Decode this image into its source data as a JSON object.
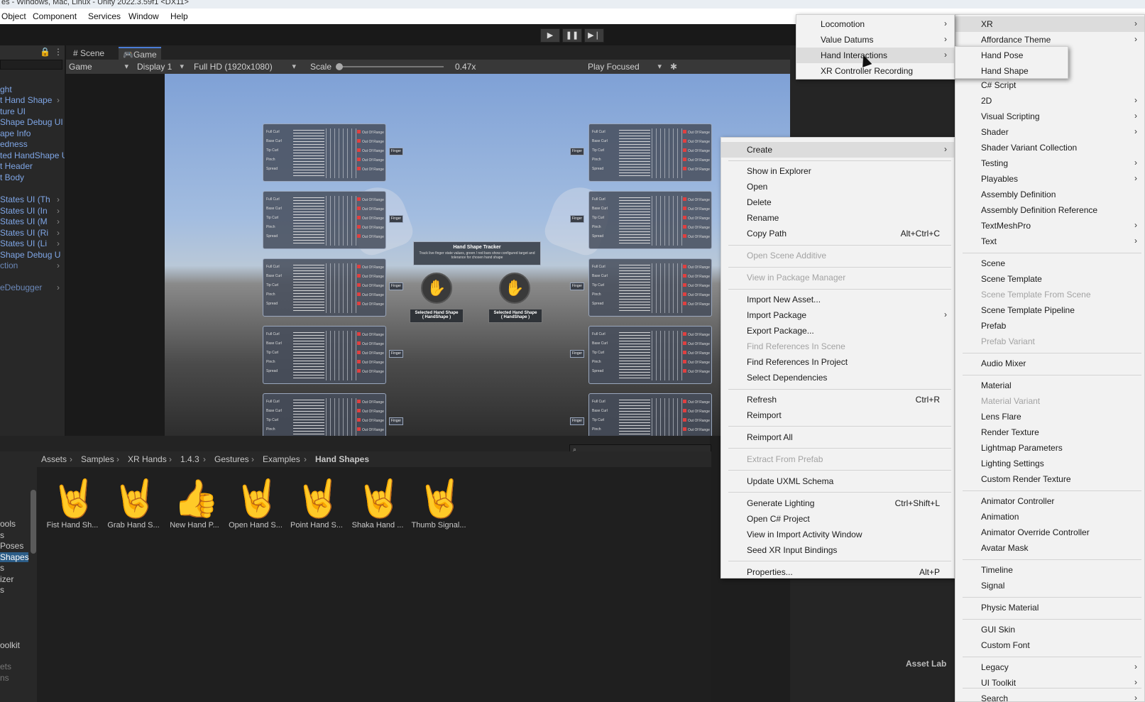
{
  "window": {
    "title": "es - Windows, Mac, Linux - Unity 2022.3.59f1 <DX11>"
  },
  "menubar": [
    "Object",
    "Component",
    "Services",
    "Window",
    "Help"
  ],
  "play_controls": {
    "play": "▶",
    "pause": "❚❚",
    "step": "▶❘"
  },
  "hierarchy": {
    "items": [
      "ght",
      "t Hand Shape",
      "ture UI",
      "Shape Debug UI",
      "ape Info",
      "edness",
      "ted HandShape U",
      "t Header",
      "t Body",
      "",
      "States UI (Th",
      "States UI (In",
      "States UI (M",
      "States UI (Ri",
      "States UI (Li",
      "Shape Debug U",
      "ction",
      "",
      "eDebugger"
    ]
  },
  "game_view": {
    "tabs": [
      "Scene",
      "Game"
    ],
    "mode": "Game",
    "display": "Display 1",
    "resolution": "Full HD (1920x1080)",
    "scale_label": "Scale",
    "scale_value": "0.47x",
    "play_mode": "Play Focused",
    "panel_rows": [
      "Full Curl",
      "Base Curl",
      "Tip Curl",
      "Pinch",
      "Spread"
    ],
    "out_of_range": "Out Of Range",
    "finger_tag": "Finger",
    "tracker_title": "Hand Shape Tracker",
    "tracker_desc": "Track live finger state values, green / red bars show configured target and tolerance for chosen hand shape",
    "selected_label": "Selected Hand Shape",
    "selected_sub": "( HandShape )"
  },
  "project": {
    "left_items": [
      "ools",
      "s",
      "Poses",
      "Shapes",
      "s",
      "izer",
      "s",
      "oolkit",
      "ets",
      "ns"
    ],
    "breadcrumb": [
      "Assets",
      "Samples",
      "XR Hands",
      "1.4.3",
      "Gestures",
      "Examples",
      "Hand Shapes"
    ],
    "assets": [
      {
        "label": "Fist Hand Sh...",
        "icon": "hand-shape-icon"
      },
      {
        "label": "Grab Hand S...",
        "icon": "hand-shape-icon"
      },
      {
        "label": "New Hand P...",
        "icon": "thumbs-up-icon"
      },
      {
        "label": "Open Hand S...",
        "icon": "hand-shape-icon"
      },
      {
        "label": "Point Hand S...",
        "icon": "hand-shape-icon"
      },
      {
        "label": "Shaka Hand ...",
        "icon": "hand-shape-icon"
      },
      {
        "label": "Thumb Signal...",
        "icon": "hand-shape-icon"
      }
    ]
  },
  "inspector": {
    "asset_labels": "Asset Lab"
  },
  "context_menu": {
    "items": [
      {
        "label": "Create",
        "submenu": true,
        "highlight": true
      },
      {
        "label": "Show in Explorer"
      },
      {
        "label": "Open"
      },
      {
        "label": "Delete"
      },
      {
        "label": "Rename"
      },
      {
        "label": "Copy Path",
        "shortcut": "Alt+Ctrl+C"
      },
      {
        "label": "Open Scene Additive",
        "disabled": true
      },
      {
        "label": "View in Package Manager",
        "disabled": true
      },
      {
        "label": "Import New Asset..."
      },
      {
        "label": "Import Package",
        "submenu": true
      },
      {
        "label": "Export Package..."
      },
      {
        "label": "Find References In Scene",
        "disabled": true
      },
      {
        "label": "Find References In Project"
      },
      {
        "label": "Select Dependencies"
      },
      {
        "label": "Refresh",
        "shortcut": "Ctrl+R"
      },
      {
        "label": "Reimport"
      },
      {
        "label": "Reimport All"
      },
      {
        "label": "Extract From Prefab",
        "disabled": true
      },
      {
        "label": "Update UXML Schema"
      },
      {
        "label": "Generate Lighting",
        "shortcut": "Ctrl+Shift+L"
      },
      {
        "label": "Open C# Project"
      },
      {
        "label": "View in Import Activity Window"
      },
      {
        "label": "Seed XR Input Bindings"
      },
      {
        "label": "Properties...",
        "shortcut": "Alt+P"
      }
    ]
  },
  "create_menu": {
    "items": [
      {
        "label": "XR",
        "submenu": true,
        "highlight": true
      },
      {
        "label": "Affordance Theme",
        "submenu": true
      },
      {
        "label": "C# Script"
      },
      {
        "label": "2D",
        "submenu": true
      },
      {
        "label": "Visual Scripting",
        "submenu": true
      },
      {
        "label": "Shader",
        "submenu": true
      },
      {
        "label": "Shader Variant Collection"
      },
      {
        "label": "Testing",
        "submenu": true
      },
      {
        "label": "Playables",
        "submenu": true
      },
      {
        "label": "Assembly Definition"
      },
      {
        "label": "Assembly Definition Reference"
      },
      {
        "label": "TextMeshPro",
        "submenu": true
      },
      {
        "label": "Text",
        "submenu": true
      },
      {
        "label": "Scene"
      },
      {
        "label": "Scene Template"
      },
      {
        "label": "Scene Template From Scene",
        "disabled": true
      },
      {
        "label": "Scene Template Pipeline"
      },
      {
        "label": "Prefab"
      },
      {
        "label": "Prefab Variant",
        "disabled": true
      },
      {
        "label": "Audio Mixer"
      },
      {
        "label": "Material"
      },
      {
        "label": "Material Variant",
        "disabled": true
      },
      {
        "label": "Lens Flare"
      },
      {
        "label": "Render Texture"
      },
      {
        "label": "Lightmap Parameters"
      },
      {
        "label": "Lighting Settings"
      },
      {
        "label": "Custom Render Texture"
      },
      {
        "label": "Animator Controller"
      },
      {
        "label": "Animation"
      },
      {
        "label": "Animator Override Controller"
      },
      {
        "label": "Avatar Mask"
      },
      {
        "label": "Timeline"
      },
      {
        "label": "Signal"
      },
      {
        "label": "Physic Material"
      },
      {
        "label": "GUI Skin"
      },
      {
        "label": "Custom Font"
      },
      {
        "label": "Legacy",
        "submenu": true
      },
      {
        "label": "UI Toolkit",
        "submenu": true
      },
      {
        "label": "Search",
        "submenu": true
      }
    ]
  },
  "xr_menu": {
    "items": [
      {
        "label": "Locomotion",
        "submenu": true
      },
      {
        "label": "Value Datums",
        "submenu": true
      },
      {
        "label": "Hand Interactions",
        "submenu": true,
        "highlight": true
      },
      {
        "label": "XR Controller Recording"
      }
    ]
  },
  "hand_menu": {
    "items": [
      {
        "label": "Hand Pose"
      },
      {
        "label": "Hand Shape"
      }
    ]
  }
}
